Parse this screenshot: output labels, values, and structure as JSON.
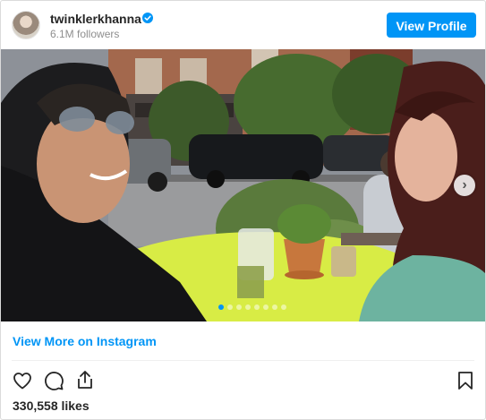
{
  "header": {
    "username": "twinklerkhanna",
    "followers": "6.1M followers",
    "view_profile_label": "View Profile"
  },
  "carousel": {
    "total_slides": 8,
    "active_slide": 1
  },
  "footer": {
    "view_more_label": "View More on Instagram",
    "likes": "330,558 likes"
  },
  "icons": [
    "verified-badge-icon",
    "chevron-right-icon",
    "heart-icon",
    "comment-icon",
    "share-icon",
    "bookmark-icon"
  ],
  "colors": {
    "accent": "#0095f6",
    "text": "#262626",
    "muted": "#8e8e8e",
    "border": "#dbdbdb"
  }
}
